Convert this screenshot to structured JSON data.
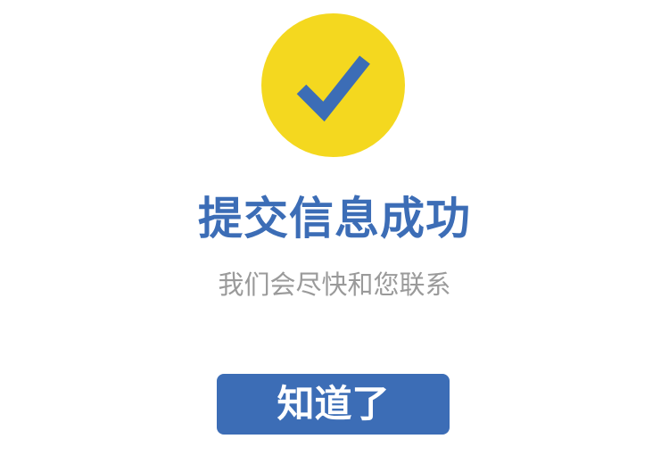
{
  "success": {
    "icon": "checkmark-icon",
    "title": "提交信息成功",
    "message": "我们会尽快和您联系",
    "button_label": "知道了"
  },
  "colors": {
    "circle": "#F4D81F",
    "accent": "#3C6DB6",
    "message_text": "#9A9A9A",
    "button_text": "#FFFFFF"
  }
}
